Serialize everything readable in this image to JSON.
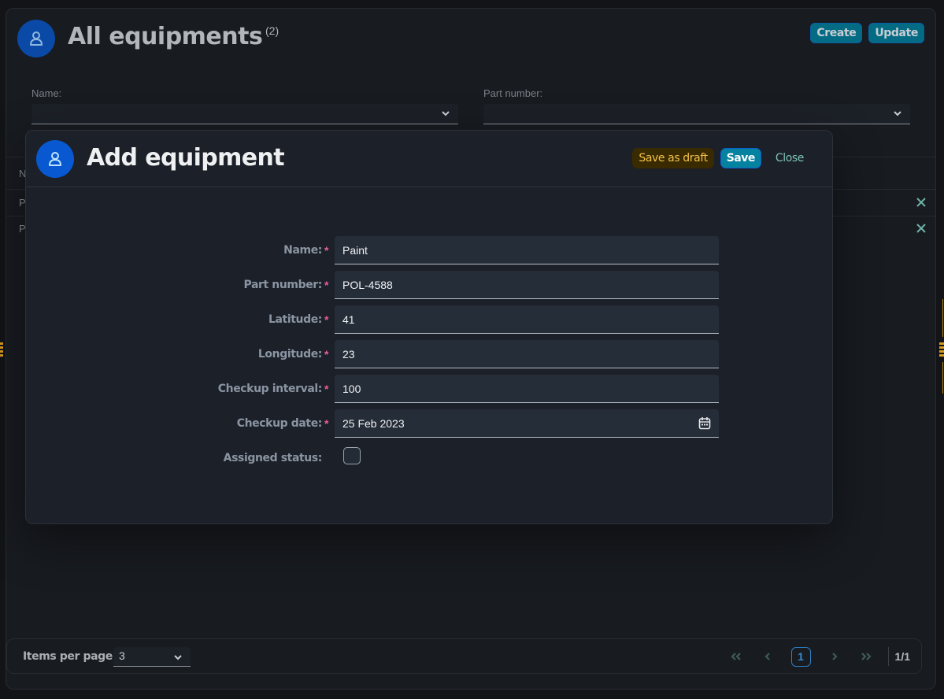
{
  "page": {
    "title": "All equipments",
    "count": "(2)",
    "avatar_icon": "user-icon",
    "actions": {
      "create_label": "Create",
      "update_label": "Update"
    },
    "filters": [
      {
        "label": "Name:",
        "value": ""
      },
      {
        "label": "Part number:",
        "value": ""
      }
    ],
    "table": {
      "header_first_char": "N",
      "rows": [
        {
          "first_char": "P",
          "delete_icon": "close-icon"
        },
        {
          "first_char": "P",
          "delete_icon": "close-icon"
        }
      ]
    },
    "footer": {
      "items_per_page_label": "Items per page",
      "items_per_page_value": "3",
      "current_page": "1",
      "page_total": "1/1"
    }
  },
  "dialog": {
    "title": "Add equipment",
    "avatar_icon": "user-icon",
    "actions": {
      "draft_label": "Save as draft",
      "save_label": "Save",
      "close_label": "Close"
    },
    "fields": [
      {
        "label": "Name:",
        "required": true,
        "value": "Paint"
      },
      {
        "label": "Part number:",
        "required": true,
        "value": "POL-4588"
      },
      {
        "label": "Latitude:",
        "required": true,
        "value": "41"
      },
      {
        "label": "Longitude:",
        "required": true,
        "value": "23"
      },
      {
        "label": "Checkup interval:",
        "required": true,
        "value": "100"
      },
      {
        "label": "Checkup date:",
        "required": true,
        "value": "25 Feb 2023"
      },
      {
        "label": "Assigned status:",
        "required": false,
        "checked": false
      }
    ],
    "required_marker": "*"
  },
  "colors": {
    "accent_teal": "#046b85",
    "save_button": "#0582a0",
    "draft_text": "#f2c14a",
    "close_text": "#7ec3b8",
    "required_marker": "#ea5d97",
    "avatar_blue": "#0859d1"
  }
}
